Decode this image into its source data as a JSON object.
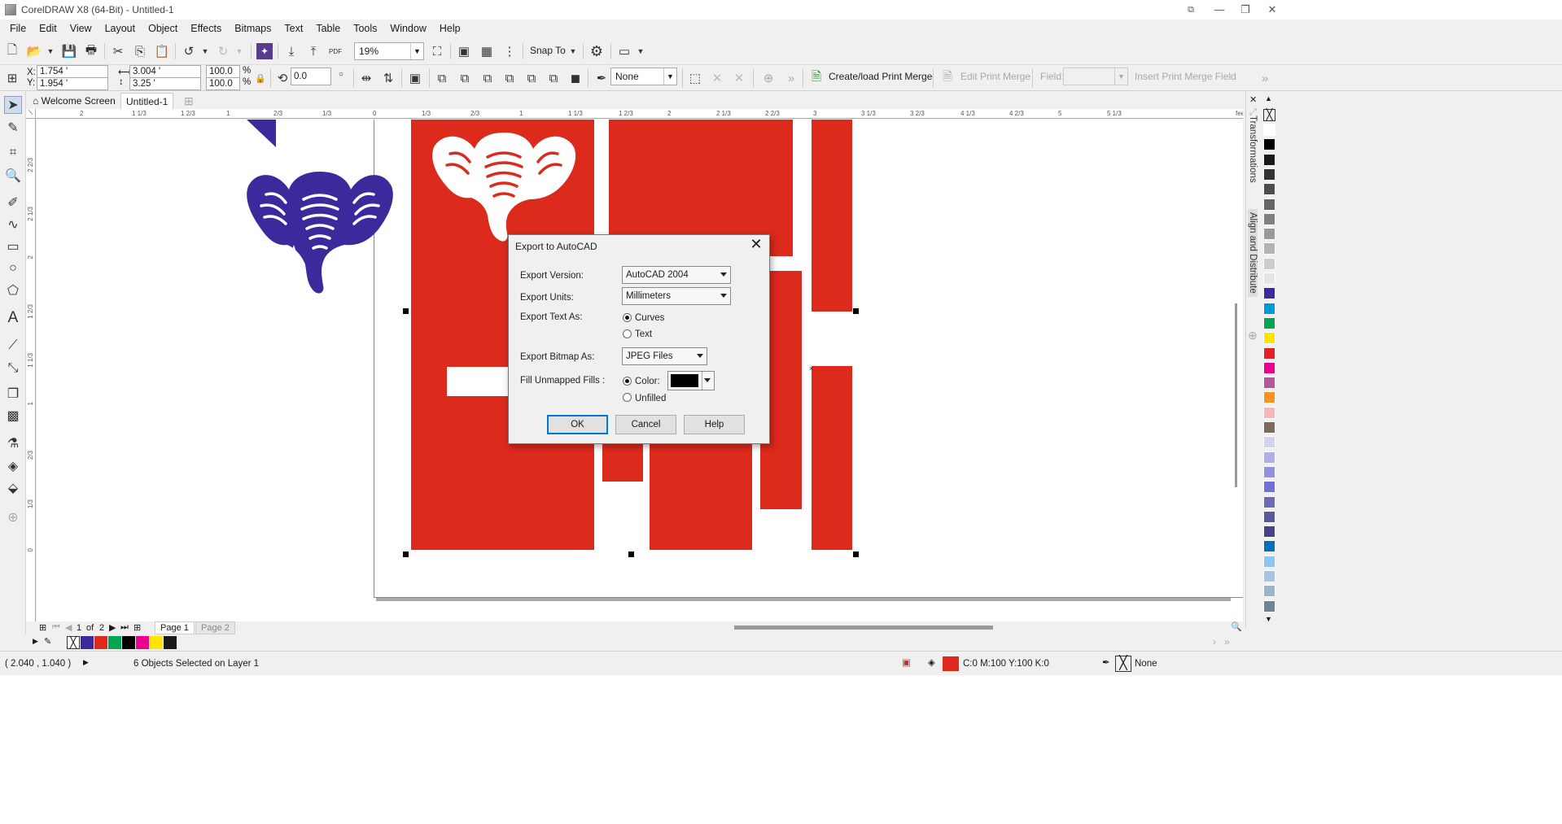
{
  "window": {
    "title": "CorelDRAW X8 (64-Bit) - Untitled-1"
  },
  "menu": [
    "File",
    "Edit",
    "View",
    "Layout",
    "Object",
    "Effects",
    "Bitmaps",
    "Text",
    "Table",
    "Tools",
    "Window",
    "Help"
  ],
  "toolbar": {
    "zoom": "19%",
    "snap_to": "Snap To",
    "pdf_label": "PDF"
  },
  "propbar": {
    "x_label": "X:",
    "x_value": "1.754 '",
    "y_label": "Y:",
    "y_value": "1.954 '",
    "w_value": "3.004 '",
    "h_value": "3.25 '",
    "scale_w": "100.0",
    "scale_h": "100.0",
    "pct": "%",
    "rotation": "0.0",
    "outline": "None",
    "print_merge": "Create/load Print Merge",
    "edit_merge": "Edit Print Merge",
    "field_label": "Field:",
    "insert_field": "Insert Print Merge Field"
  },
  "tabs": {
    "welcome": "Welcome Screen",
    "doc": "Untitled-1"
  },
  "ruler": {
    "h_ticks": [
      "2",
      "1 1/3",
      "1 2/3",
      "1",
      "2/3",
      "1/3",
      "0",
      "1/3",
      "2/3",
      "1",
      "1 1/3",
      "1 2/3",
      "2",
      "2 1/3",
      "2 2/3",
      "3",
      "3 1/3",
      "3 2/3",
      "4 1/3",
      "4 2/3",
      "5",
      "5 1/3",
      "feet"
    ],
    "v_ticks": [
      "2 2/3",
      "2 1/3",
      "2",
      "1 2/3",
      "1 1/3",
      "1",
      "2/3",
      "1/3",
      "0"
    ]
  },
  "dialog": {
    "title": "Export to AutoCAD",
    "version_label": "Export Version:",
    "version_value": "AutoCAD 2004",
    "units_label": "Export Units:",
    "units_value": "Millimeters",
    "text_label": "Export Text As:",
    "text_opt_curves": "Curves",
    "text_opt_text": "Text",
    "bitmap_label": "Export Bitmap As:",
    "bitmap_value": "JPEG Files",
    "fill_label": "Fill Unmapped Fills :",
    "fill_opt_color": "Color:",
    "fill_opt_unfilled": "Unfilled",
    "ok": "OK",
    "cancel": "Cancel",
    "help": "Help"
  },
  "docker": {
    "tab1": "Transformations",
    "tab2": "Align and Distribute"
  },
  "pagenav": {
    "current": "1",
    "of": "of",
    "total": "2",
    "page1": "Page 1",
    "page2": "Page 2"
  },
  "status": {
    "coords": "( 2.040 , 1.040 )",
    "selection": "6 Objects Selected on Layer 1",
    "fill_info": "C:0 M:100 Y:100 K:0",
    "outline_info": "None"
  },
  "colors": {
    "accent_red": "#dc2a1c",
    "elephant_blue": "#3b2a9c",
    "selection": "#0078d7"
  },
  "palette": [
    "#ffffff",
    "#000000",
    "#1a1a1a",
    "#333333",
    "#4d4d4d",
    "#666666",
    "#808080",
    "#999999",
    "#b3b3b3",
    "#cccccc",
    "#e6e6e6",
    "#3b2a9c",
    "#0099d8",
    "#00a651",
    "#ffe500",
    "#e31e24",
    "#ec008c",
    "#b3569b",
    "#f7931e",
    "#f9b8b8",
    "#7d6a5b",
    "#d3d3f0",
    "#b0aee8",
    "#9191e0",
    "#7070d8",
    "#6b6bb8",
    "#5858a0",
    "#444488",
    "#0072bc",
    "#8ec6ef",
    "#a7c5e0",
    "#9bb6c8",
    "#6b8596"
  ],
  "doc_palette": [
    "#3b2a9c",
    "#dc2a1c",
    "#00a651",
    "#000000",
    "#ec008c",
    "#ffe500",
    "#1a1a1a"
  ]
}
